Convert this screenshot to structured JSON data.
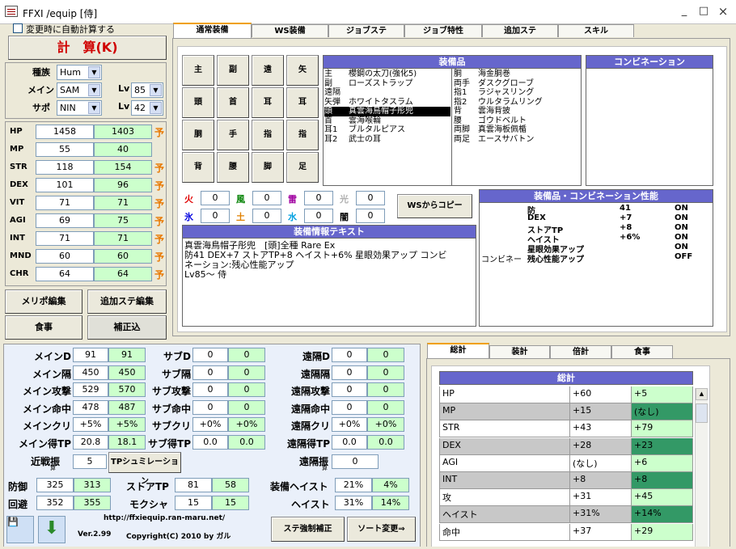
{
  "window": {
    "title": "FFXI /equip [侍]",
    "min": "_",
    "max": "□",
    "close": "×"
  },
  "autocalc": {
    "label": "変更時に自動計算する"
  },
  "calc_button": "計　算(K)",
  "basic": {
    "race_label": "種族",
    "race": "Hum",
    "main_label": "メイン",
    "main": "SAM",
    "sub_label": "サポ",
    "sub": "NIN",
    "lv_label1": "Lv",
    "lv1": "85",
    "lv_label2": "Lv",
    "lv2": "42"
  },
  "stats": [
    {
      "name": "HP",
      "a": "1458",
      "b": "1403",
      "yo": "予"
    },
    {
      "name": "MP",
      "a": "55",
      "b": "40",
      "yo": ""
    },
    {
      "name": "STR",
      "a": "118",
      "b": "154",
      "yo": "予"
    },
    {
      "name": "DEX",
      "a": "101",
      "b": "96",
      "yo": "予"
    },
    {
      "name": "VIT",
      "a": "71",
      "b": "71",
      "yo": "予"
    },
    {
      "name": "AGI",
      "a": "69",
      "b": "75",
      "yo": "予"
    },
    {
      "name": "INT",
      "a": "71",
      "b": "71",
      "yo": "予"
    },
    {
      "name": "MND",
      "a": "60",
      "b": "60",
      "yo": "予"
    },
    {
      "name": "CHR",
      "a": "64",
      "b": "64",
      "yo": "予"
    }
  ],
  "left_buttons": {
    "merit": "メリポ編集",
    "addstat": "追加ステ編集",
    "food": "食事",
    "correction": "補正込"
  },
  "tabs": [
    "通常装備",
    "WS装備",
    "ジョブステ",
    "ジョブ特性",
    "追加ステ",
    "スキル"
  ],
  "slots": [
    "主",
    "副",
    "遠",
    "矢",
    "頭",
    "首",
    "耳",
    "耳",
    "胴",
    "手",
    "指",
    "指",
    "背",
    "腰",
    "脚",
    "足"
  ],
  "equip": {
    "header": "装備品",
    "left": [
      [
        "主",
        "櫻鋼の太刀(強化5)"
      ],
      [
        "副",
        "ローズストラップ"
      ],
      [
        "遠隔",
        ""
      ],
      [
        "矢弾",
        "ホワイトタスラム"
      ],
      [
        "頭",
        "真雲海鳥帽子彤兜"
      ],
      [
        "首",
        "雲海喉輪"
      ],
      [
        "耳1",
        "ブルタルピアス"
      ],
      [
        "耳2",
        "武士の耳"
      ]
    ],
    "right": [
      [
        "胴",
        "海金胴巻"
      ],
      [
        "両手",
        "ダスクグローブ"
      ],
      [
        "指1",
        "ラジャスリング"
      ],
      [
        "指2",
        "ウルタラムリング"
      ],
      [
        "背",
        "雲海背披"
      ],
      [
        "腰",
        "ゴウドベルト"
      ],
      [
        "両脚",
        "真雲海板佩楯"
      ],
      [
        "両足",
        "エースサバトン"
      ]
    ]
  },
  "combo": {
    "header": "コンビネーション"
  },
  "elements": [
    {
      "k": "火",
      "v": "0",
      "c": "#e00000"
    },
    {
      "k": "風",
      "v": "0",
      "c": "#008000"
    },
    {
      "k": "雷",
      "v": "0",
      "c": "#a000a0"
    },
    {
      "k": "光",
      "v": "0",
      "c": "#b0b0b0"
    },
    {
      "k": "氷",
      "v": "0",
      "c": "#0000e0"
    },
    {
      "k": "土",
      "v": "0",
      "c": "#e08000"
    },
    {
      "k": "水",
      "v": "0",
      "c": "#00a0e0"
    },
    {
      "k": "闇",
      "v": "0",
      "c": "#000000"
    }
  ],
  "ws_copy": "WSからコピー",
  "info": {
    "header": "装備情報テキスト",
    "lines": [
      "真雲海鳥帽子彤兜　[頭]全種 Rare Ex",
      "防41 DEX+7 ストアTP+8 ヘイスト+6% 星眼効果アップ コンビ",
      "ネーション:残心性能アップ",
      "Lv85～ 侍"
    ]
  },
  "perf": {
    "header": "装備品・コンビネーション性能",
    "rows": [
      [
        "",
        "防",
        "41",
        "ON"
      ],
      [
        "",
        "DEX",
        "+7",
        "ON"
      ],
      [
        "",
        "ストアTP",
        "+8",
        "ON"
      ],
      [
        "",
        "ヘイスト",
        "+6%",
        "ON"
      ],
      [
        "",
        "星眼効果アップ",
        "",
        "ON"
      ],
      [
        "コンビネー",
        "残心性能アップ",
        "",
        "OFF"
      ]
    ]
  },
  "combat": {
    "col1": [
      {
        "l": "メインD",
        "a": "91",
        "b": "91"
      },
      {
        "l": "メイン隔",
        "a": "450",
        "b": "450"
      },
      {
        "l": "メイン攻撃",
        "a": "529",
        "b": "570"
      },
      {
        "l": "メイン命中",
        "a": "478",
        "b": "487"
      },
      {
        "l": "メインクリ",
        "a": "+5%",
        "b": "+5%"
      },
      {
        "l": "メイン得TP",
        "a": "20.8",
        "b": "18.1"
      }
    ],
    "col2": [
      {
        "l": "サブD",
        "a": "0",
        "b": "0"
      },
      {
        "l": "サブ隔",
        "a": "0",
        "b": "0"
      },
      {
        "l": "サブ攻撃",
        "a": "0",
        "b": "0"
      },
      {
        "l": "サブ命中",
        "a": "0",
        "b": "0"
      },
      {
        "l": "サブクリ",
        "a": "+0%",
        "b": "+0%"
      },
      {
        "l": "サブ得TP",
        "a": "0.0",
        "b": "0.0"
      }
    ],
    "col3": [
      {
        "l": "遠隔D",
        "a": "0",
        "b": "0"
      },
      {
        "l": "遠隔隔",
        "a": "0",
        "b": "0"
      },
      {
        "l": "遠隔攻撃",
        "a": "0",
        "b": "0"
      },
      {
        "l": "遠隔命中",
        "a": "0",
        "b": "0"
      },
      {
        "l": "遠隔クリ",
        "a": "+0%",
        "b": "+0%"
      },
      {
        "l": "遠隔得TP",
        "a": "0.0",
        "b": "0.0"
      }
    ],
    "melee_label": "近戦振",
    "melee_sub": "算",
    "melee": "5",
    "tpsim": "TPシュミレーション",
    "ranged_label": "遠隔振",
    "ranged_sub": "算",
    "ranged": "0",
    "def_label": "防御",
    "def_a": "325",
    "def_b": "313",
    "stp_label": "ストアTP",
    "stp_a": "81",
    "stp_b": "58",
    "eqhaste_label": "装備ヘイスト",
    "eqhaste_a": "21%",
    "eqhaste_b": "4%",
    "eva_label": "回避",
    "eva_a": "352",
    "eva_b": "355",
    "moku_label": "モクシャ",
    "moku_a": "15",
    "moku_b": "15",
    "haste_label": "ヘイスト",
    "haste_a": "31%",
    "haste_b": "14%"
  },
  "footer": {
    "url": "http://ffxiequip.ran-maru.net/",
    "version": "Ver.2.99",
    "copyright": "Copyright(C) 2010 by ガル",
    "force": "ステ強制補正",
    "sort": "ソート変更⇒"
  },
  "rtabs": [
    "総計",
    "装計",
    "倍計",
    "食事"
  ],
  "total": {
    "header": "総計",
    "rows": [
      [
        "HP",
        "+60",
        "+5"
      ],
      [
        "MP",
        "+15",
        "(なし)"
      ],
      [
        "STR",
        "+43",
        "+79"
      ],
      [
        "DEX",
        "+28",
        "+23"
      ],
      [
        "AGI",
        "(なし)",
        "+6"
      ],
      [
        "INT",
        "+8",
        "+8"
      ],
      [
        "攻",
        "+31",
        "+45"
      ],
      [
        "ヘイスト",
        "+31%",
        "+14%"
      ],
      [
        "命中",
        "+37",
        "+29"
      ]
    ]
  }
}
